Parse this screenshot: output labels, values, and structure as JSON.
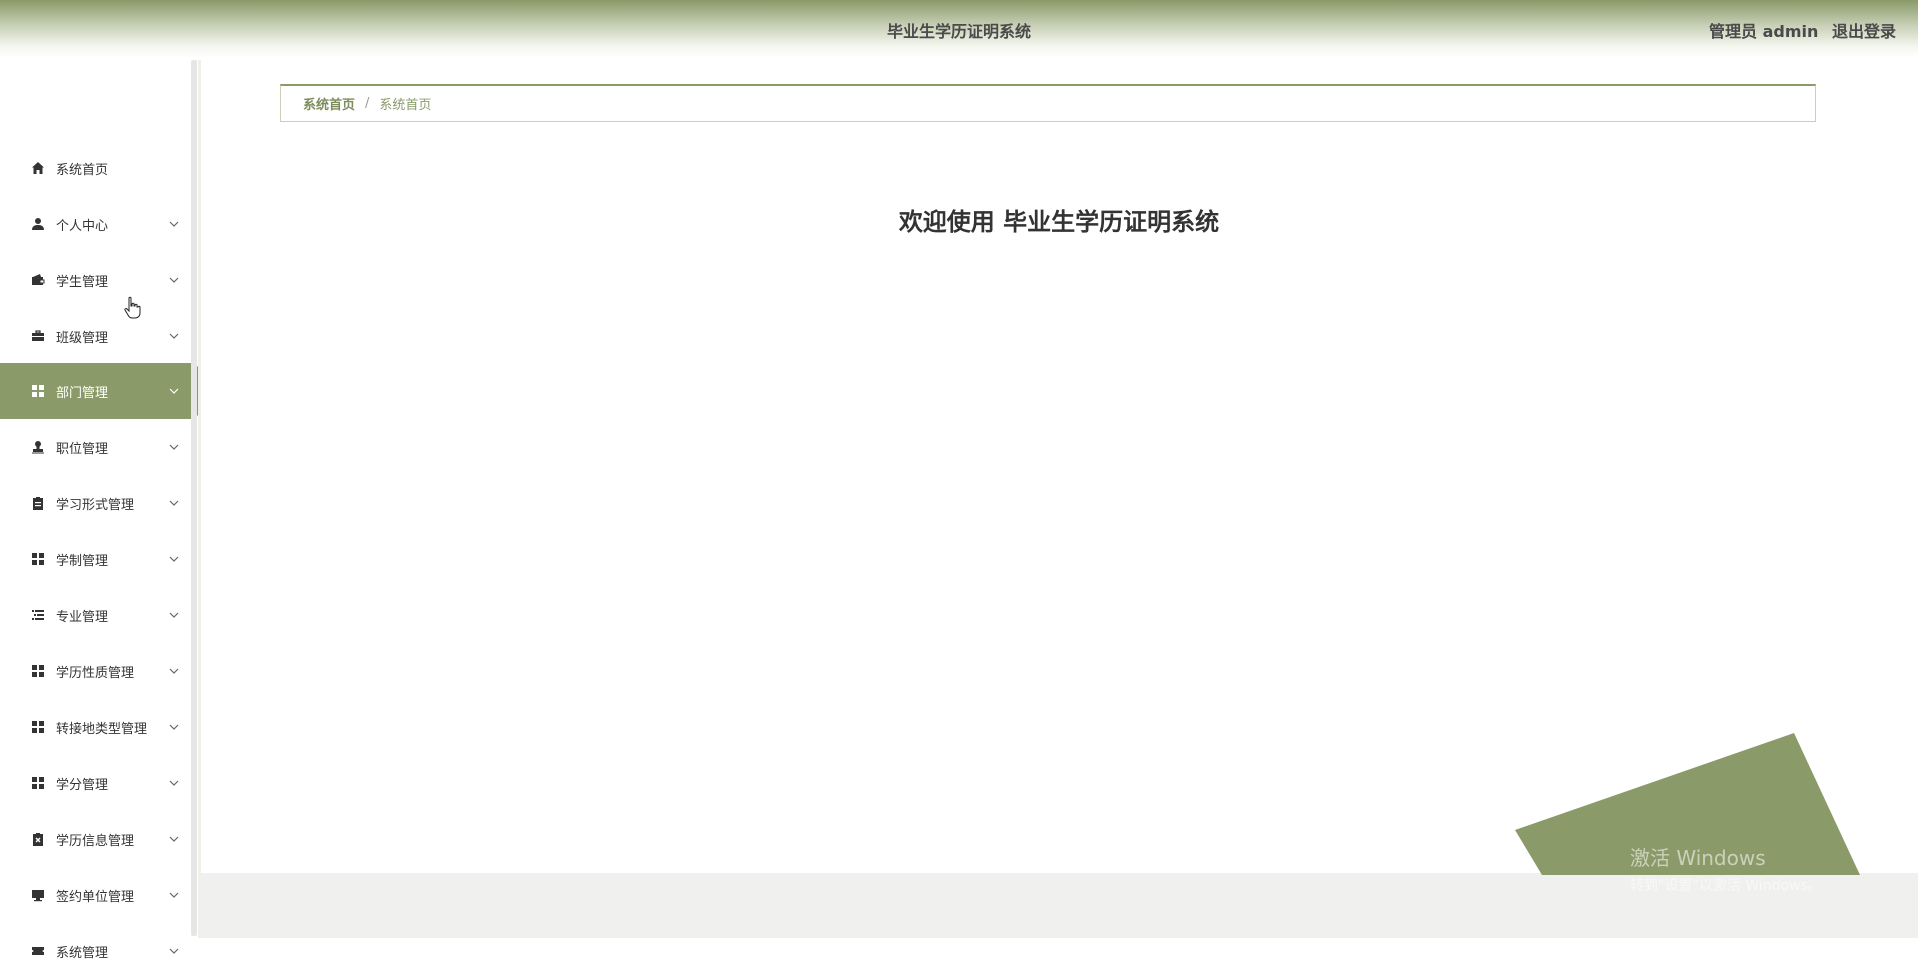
{
  "header": {
    "title": "毕业生学历证明系统",
    "user": "管理员 admin",
    "logout": "退出登录"
  },
  "sidebar": {
    "items": [
      {
        "label": "系统首页",
        "icon": "home-icon"
      },
      {
        "label": "个人中心",
        "icon": "user-icon"
      },
      {
        "label": "学生管理",
        "icon": "wallet-icon"
      },
      {
        "label": "班级管理",
        "icon": "briefcase-icon"
      },
      {
        "label": "部门管理",
        "icon": "grid-icon"
      },
      {
        "label": "职位管理",
        "icon": "stamp-icon"
      },
      {
        "label": "学习形式管理",
        "icon": "clipboard-icon"
      },
      {
        "label": "学制管理",
        "icon": "grid-icon"
      },
      {
        "label": "专业管理",
        "icon": "list-icon"
      },
      {
        "label": "学历性质管理",
        "icon": "grid-icon"
      },
      {
        "label": "转接地类型管理",
        "icon": "grid-icon"
      },
      {
        "label": "学分管理",
        "icon": "grid-icon"
      },
      {
        "label": "学历信息管理",
        "icon": "clipboard-x-icon"
      },
      {
        "label": "签约单位管理",
        "icon": "monitor-icon"
      },
      {
        "label": "系统管理",
        "icon": "ticket-icon"
      }
    ],
    "active_index": 4
  },
  "breadcrumb": {
    "first": "系统首页",
    "separator": "/",
    "second": "系统首页"
  },
  "main": {
    "welcome": "欢迎使用 毕业生学历证明系统"
  },
  "watermark": {
    "line1": "激活 Windows",
    "line2": "转到\"设置\"以激活 Windows。"
  },
  "colors": {
    "accent": "#8a9a69",
    "text": "#333333"
  }
}
